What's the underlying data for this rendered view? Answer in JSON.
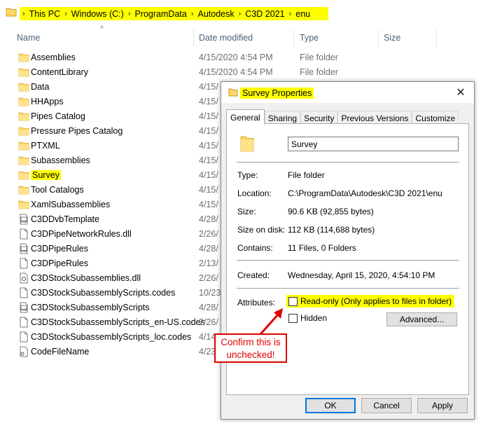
{
  "breadcrumb": [
    "This PC",
    "Windows (C:)",
    "ProgramData",
    "Autodesk",
    "C3D 2021",
    "enu"
  ],
  "columns": {
    "name": "Name",
    "date": "Date modified",
    "type": "Type",
    "size": "Size"
  },
  "files": [
    {
      "name": "Assemblies",
      "date": "4/15/2020 4:54 PM",
      "type": "File folder",
      "icon": "folder-icon"
    },
    {
      "name": "ContentLibrary",
      "date": "4/15/2020 4:54 PM",
      "type": "File folder",
      "icon": "folder-icon"
    },
    {
      "name": "Data",
      "date": "4/15/",
      "type": "",
      "icon": "folder-icon"
    },
    {
      "name": "HHApps",
      "date": "4/15/",
      "type": "",
      "icon": "folder-icon"
    },
    {
      "name": "Pipes Catalog",
      "date": "4/15/",
      "type": "",
      "icon": "folder-icon"
    },
    {
      "name": "Pressure Pipes Catalog",
      "date": "4/15/",
      "type": "",
      "icon": "folder-icon"
    },
    {
      "name": "PTXML",
      "date": "4/15/",
      "type": "",
      "icon": "folder-icon"
    },
    {
      "name": "Subassemblies",
      "date": "4/15/",
      "type": "",
      "icon": "folder-icon"
    },
    {
      "name": "Survey",
      "date": "4/15/",
      "type": "",
      "icon": "folder-icon",
      "highlighted": true
    },
    {
      "name": "Tool Catalogs",
      "date": "4/15/",
      "type": "",
      "icon": "folder-icon"
    },
    {
      "name": "XamlSubassemblies",
      "date": "4/15/",
      "type": "",
      "icon": "folder-icon"
    },
    {
      "name": "C3DDvbTemplate",
      "date": "4/28/",
      "type": "",
      "icon": "dvb-file-icon"
    },
    {
      "name": "C3DPipeNetworkRules.dll",
      "date": "2/26/",
      "type": "",
      "icon": "file-icon"
    },
    {
      "name": "C3DPipeRules",
      "date": "4/28/",
      "type": "",
      "icon": "dvb-file-icon"
    },
    {
      "name": "C3DPipeRules",
      "date": "2/13/",
      "type": "",
      "icon": "file-icon"
    },
    {
      "name": "C3DStockSubassemblies.dll",
      "date": "2/26/",
      "type": "",
      "icon": "dll-file-icon"
    },
    {
      "name": "C3DStockSubassemblyScripts.codes",
      "date": "10/23/",
      "type": "",
      "icon": "file-icon"
    },
    {
      "name": "C3DStockSubassemblyScripts",
      "date": "4/28/",
      "type": "",
      "icon": "dvb-file-icon"
    },
    {
      "name": "C3DStockSubassemblyScripts_en-US.codes",
      "date": "2/26/",
      "type": "",
      "icon": "file-icon"
    },
    {
      "name": "C3DStockSubassemblyScripts_loc.codes",
      "date": "4/14/",
      "type": "",
      "icon": "file-icon"
    },
    {
      "name": "CodeFileName",
      "date": "4/23/",
      "type": "",
      "icon": "config-file-icon"
    }
  ],
  "dialog": {
    "title": "Survey Properties",
    "close": "✕",
    "tabs": [
      "General",
      "Sharing",
      "Security",
      "Previous Versions",
      "Customize"
    ],
    "name_value": "Survey",
    "props": {
      "type_label": "Type:",
      "type_value": "File folder",
      "location_label": "Location:",
      "location_value": "C:\\ProgramData\\Autodesk\\C3D 2021\\enu",
      "size_label": "Size:",
      "size_value": "90.6 KB (92,855 bytes)",
      "size_on_disk_label": "Size on disk:",
      "size_on_disk_value": "112 KB (114,688 bytes)",
      "contains_label": "Contains:",
      "contains_value": "11 Files, 0 Folders",
      "created_label": "Created:",
      "created_value": "Wednesday, April 15, 2020, 4:54:10 PM",
      "attributes_label": "Attributes:"
    },
    "readonly_label": "Read-only (Only applies to files in folder)",
    "readonly_checked": false,
    "hidden_label": "Hidden",
    "hidden_checked": false,
    "advanced_label": "Advanced...",
    "ok_label": "OK",
    "cancel_label": "Cancel",
    "apply_label": "Apply"
  },
  "callout": {
    "line1": "Confirm this is",
    "line2": "unchecked!"
  },
  "colors": {
    "highlight": "#ffff00",
    "callout_red": "#e00000",
    "folder_yellow": "#ffd766"
  }
}
